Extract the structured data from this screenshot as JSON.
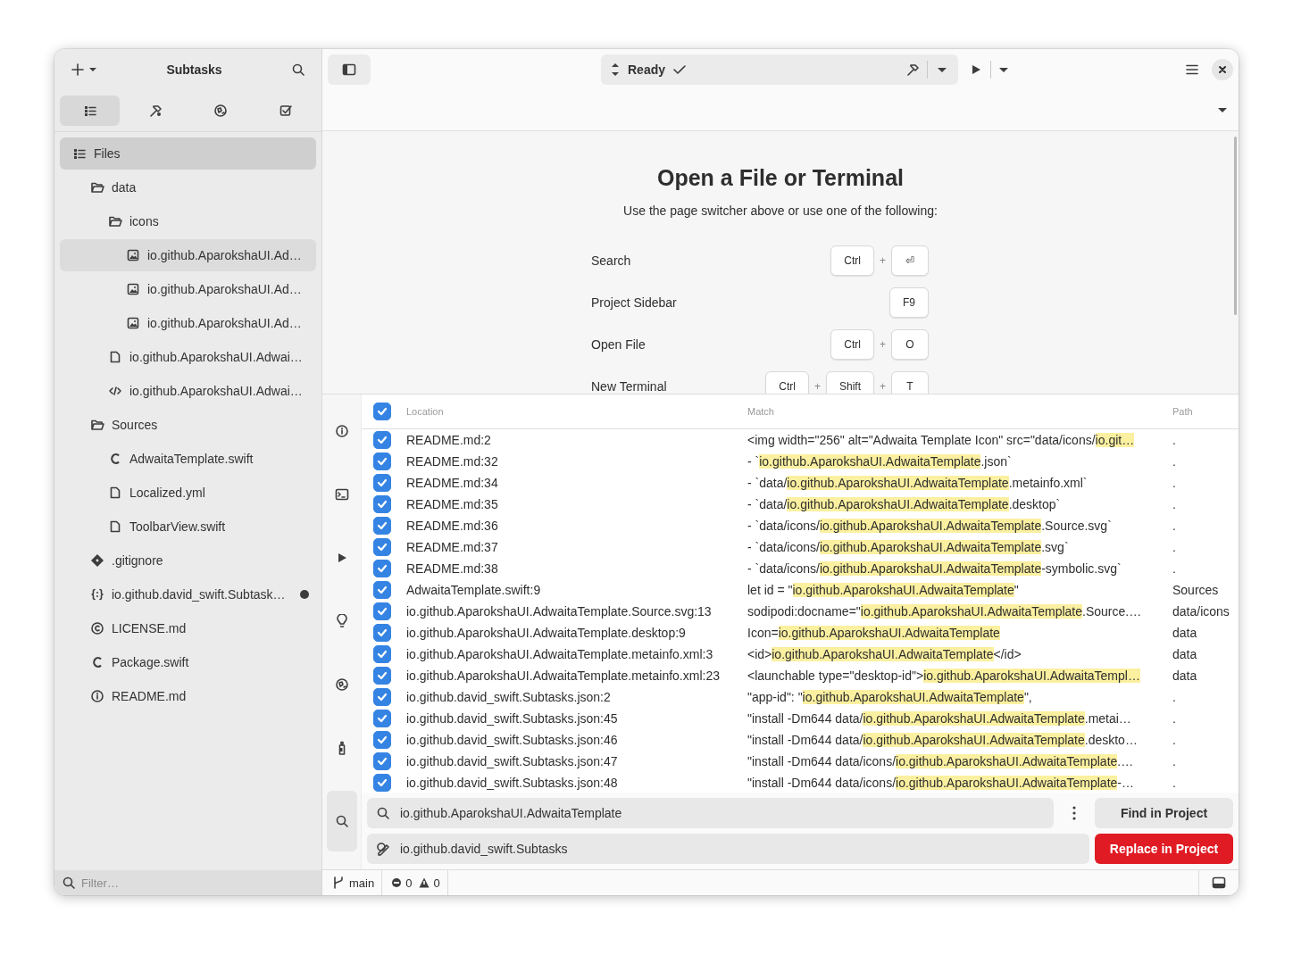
{
  "sidebar": {
    "title": "Subtasks",
    "tabs": [
      {
        "kind": "list",
        "selected": true
      },
      {
        "kind": "hammer",
        "selected": false
      },
      {
        "kind": "globe",
        "selected": false
      },
      {
        "kind": "check",
        "selected": false
      }
    ],
    "tree": [
      {
        "label": "Files",
        "kind": "list",
        "selected": true,
        "children": [
          {
            "label": "data",
            "kind": "folder",
            "selected": false,
            "children": [
              {
                "label": "icons",
                "kind": "folder",
                "selected": false,
                "children": [
                  {
                    "label": "io.github.AparokshaUI.Ad…",
                    "kind": "image",
                    "selected": false,
                    "focused": true
                  },
                  {
                    "label": "io.github.AparokshaUI.Ad…",
                    "kind": "image",
                    "selected": false
                  },
                  {
                    "label": "io.github.AparokshaUI.Ad…",
                    "kind": "image",
                    "selected": false
                  }
                ]
              },
              {
                "label": "io.github.AparokshaUI.Adwai…",
                "kind": "file",
                "selected": false
              },
              {
                "label": "io.github.AparokshaUI.Adwai…",
                "kind": "code",
                "selected": false
              }
            ]
          },
          {
            "label": "Sources",
            "kind": "folder",
            "selected": false,
            "children": [
              {
                "label": "AdwaitaTemplate.swift",
                "kind": "swift",
                "selected": false
              },
              {
                "label": "Localized.yml",
                "kind": "file",
                "selected": false
              },
              {
                "label": "ToolbarView.swift",
                "kind": "file",
                "selected": false
              }
            ]
          },
          {
            "label": ".gitignore",
            "kind": "git",
            "selected": false
          },
          {
            "label": "io.github.david_swift.Subtask…",
            "kind": "json",
            "selected": false,
            "modified": true
          },
          {
            "label": "LICENSE.md",
            "kind": "license",
            "selected": false
          },
          {
            "label": "Package.swift",
            "kind": "swift",
            "selected": false
          },
          {
            "label": "README.md",
            "kind": "info",
            "selected": false
          }
        ]
      }
    ],
    "filter": {
      "placeholder": "Filter…"
    }
  },
  "toolbar": {
    "status": "Ready"
  },
  "welcome": {
    "title": "Open a File or Terminal",
    "subtitle": "Use the page switcher above or use one of the following:",
    "shortcuts": [
      {
        "label": "Search",
        "keys": [
          {
            "kind": "key",
            "text": "Ctrl"
          },
          {
            "kind": "plus",
            "text": "+"
          },
          {
            "kind": "key",
            "text": "⏎"
          }
        ]
      },
      {
        "label": "Project Sidebar",
        "keys": [
          {
            "kind": "key",
            "text": "F9"
          }
        ]
      },
      {
        "label": "Open File",
        "keys": [
          {
            "kind": "key",
            "text": "Ctrl"
          },
          {
            "kind": "plus",
            "text": "+"
          },
          {
            "kind": "key",
            "text": "O"
          }
        ]
      },
      {
        "label": "New Terminal",
        "keys": [
          {
            "kind": "key",
            "text": "Ctrl"
          },
          {
            "kind": "plus",
            "text": "+"
          },
          {
            "kind": "key",
            "text": "Shift"
          },
          {
            "kind": "plus",
            "text": "+"
          },
          {
            "kind": "key",
            "text": "T"
          }
        ]
      }
    ]
  },
  "panel_tabs": [
    {
      "kind": "info",
      "selected": false
    },
    {
      "kind": "terminal",
      "selected": false
    },
    {
      "kind": "play",
      "selected": false
    },
    {
      "kind": "bulb",
      "selected": false
    },
    {
      "kind": "globe",
      "selected": false
    },
    {
      "kind": "bottle",
      "selected": false
    },
    {
      "kind": "search",
      "selected": true
    }
  ],
  "results": {
    "all_checked": true,
    "columns": [
      "Location",
      "Match",
      "Path"
    ],
    "rows": [
      {
        "checked": true,
        "location": "README.md:2",
        "match": [
          {
            "text": "<img width=\"256\" alt=\"Adwaita Template Icon\" src=\"data/icons/",
            "highlight": false
          },
          {
            "text": "io.git…",
            "highlight": true
          }
        ],
        "path": "."
      },
      {
        "checked": true,
        "location": "README.md:32",
        "match": [
          {
            "text": "- `",
            "highlight": false
          },
          {
            "text": "io.github.AparokshaUI.AdwaitaTemplate",
            "highlight": true
          },
          {
            "text": ".json`",
            "highlight": false
          }
        ],
        "path": "."
      },
      {
        "checked": true,
        "location": "README.md:34",
        "match": [
          {
            "text": "- `data/",
            "highlight": false
          },
          {
            "text": "io.github.AparokshaUI.AdwaitaTemplate",
            "highlight": true
          },
          {
            "text": ".metainfo.xml`",
            "highlight": false
          }
        ],
        "path": "."
      },
      {
        "checked": true,
        "location": "README.md:35",
        "match": [
          {
            "text": "- `data/",
            "highlight": false
          },
          {
            "text": "io.github.AparokshaUI.AdwaitaTemplate",
            "highlight": true
          },
          {
            "text": ".desktop`",
            "highlight": false
          }
        ],
        "path": "."
      },
      {
        "checked": true,
        "location": "README.md:36",
        "match": [
          {
            "text": "- `data/icons/",
            "highlight": false
          },
          {
            "text": "io.github.AparokshaUI.AdwaitaTemplate",
            "highlight": true
          },
          {
            "text": ".Source.svg`",
            "highlight": false
          }
        ],
        "path": "."
      },
      {
        "checked": true,
        "location": "README.md:37",
        "match": [
          {
            "text": "- `data/icons/",
            "highlight": false
          },
          {
            "text": "io.github.AparokshaUI.AdwaitaTemplate",
            "highlight": true
          },
          {
            "text": ".svg`",
            "highlight": false
          }
        ],
        "path": "."
      },
      {
        "checked": true,
        "location": "README.md:38",
        "match": [
          {
            "text": "- `data/icons/",
            "highlight": false
          },
          {
            "text": "io.github.AparokshaUI.AdwaitaTemplate",
            "highlight": true
          },
          {
            "text": "-symbolic.svg`",
            "highlight": false
          }
        ],
        "path": "."
      },
      {
        "checked": true,
        "location": "AdwaitaTemplate.swift:9",
        "match": [
          {
            "text": "let id = \"",
            "highlight": false
          },
          {
            "text": "io.github.AparokshaUI.AdwaitaTemplate",
            "highlight": true
          },
          {
            "text": "\"",
            "highlight": false
          }
        ],
        "path": "Sources"
      },
      {
        "checked": true,
        "location": "io.github.AparokshaUI.AdwaitaTemplate.Source.svg:13",
        "match": [
          {
            "text": "sodipodi:docname=\"",
            "highlight": false
          },
          {
            "text": "io.github.AparokshaUI.AdwaitaTemplate",
            "highlight": true
          },
          {
            "text": ".Source.…",
            "highlight": false
          }
        ],
        "path": "data/icons"
      },
      {
        "checked": true,
        "location": "io.github.AparokshaUI.AdwaitaTemplate.desktop:9",
        "match": [
          {
            "text": "Icon=",
            "highlight": false
          },
          {
            "text": "io.github.AparokshaUI.AdwaitaTemplate",
            "highlight": true
          }
        ],
        "path": "data"
      },
      {
        "checked": true,
        "location": "io.github.AparokshaUI.AdwaitaTemplate.metainfo.xml:3",
        "match": [
          {
            "text": "<id>",
            "highlight": false
          },
          {
            "text": "io.github.AparokshaUI.AdwaitaTemplate",
            "highlight": true
          },
          {
            "text": "</id>",
            "highlight": false
          }
        ],
        "path": "data"
      },
      {
        "checked": true,
        "location": "io.github.AparokshaUI.AdwaitaTemplate.metainfo.xml:23",
        "match": [
          {
            "text": "<launchable type=\"desktop-id\">",
            "highlight": false
          },
          {
            "text": "io.github.AparokshaUI.AdwaitaTempl…",
            "highlight": true
          }
        ],
        "path": "data"
      },
      {
        "checked": true,
        "location": "io.github.david_swift.Subtasks.json:2",
        "match": [
          {
            "text": "\"app-id\": \"",
            "highlight": false
          },
          {
            "text": "io.github.AparokshaUI.AdwaitaTemplate",
            "highlight": true
          },
          {
            "text": "\",",
            "highlight": false
          }
        ],
        "path": "."
      },
      {
        "checked": true,
        "location": "io.github.david_swift.Subtasks.json:45",
        "match": [
          {
            "text": "\"install -Dm644 data/",
            "highlight": false
          },
          {
            "text": "io.github.AparokshaUI.AdwaitaTemplate",
            "highlight": true
          },
          {
            "text": ".metai…",
            "highlight": false
          }
        ],
        "path": "."
      },
      {
        "checked": true,
        "location": "io.github.david_swift.Subtasks.json:46",
        "match": [
          {
            "text": "\"install -Dm644 data/",
            "highlight": false
          },
          {
            "text": "io.github.AparokshaUI.AdwaitaTemplate",
            "highlight": true
          },
          {
            "text": ".deskto…",
            "highlight": false
          }
        ],
        "path": "."
      },
      {
        "checked": true,
        "location": "io.github.david_swift.Subtasks.json:47",
        "match": [
          {
            "text": "\"install -Dm644 data/icons/",
            "highlight": false
          },
          {
            "text": "io.github.AparokshaUI.AdwaitaTemplate",
            "highlight": true
          },
          {
            "text": ".…",
            "highlight": false
          }
        ],
        "path": "."
      },
      {
        "checked": true,
        "location": "io.github.david_swift.Subtasks.json:48",
        "match": [
          {
            "text": "\"install -Dm644 data/icons/",
            "highlight": false
          },
          {
            "text": "io.github.AparokshaUI.AdwaitaTemplate",
            "highlight": true
          },
          {
            "text": "-…",
            "highlight": false
          }
        ],
        "path": "."
      }
    ]
  },
  "search": {
    "find": "io.github.AparokshaUI.AdwaitaTemplate",
    "replace": "io.github.david_swift.Subtasks",
    "find_button": "Find in Project",
    "replace_button": "Replace in Project"
  },
  "status_bar": {
    "branch": "main",
    "errors": "0",
    "warnings": "0"
  }
}
